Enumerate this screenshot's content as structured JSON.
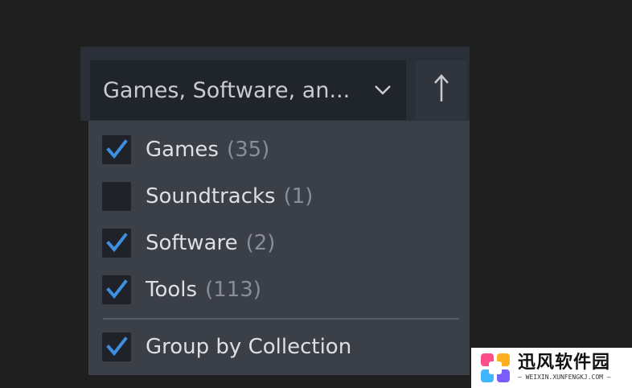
{
  "filter_dropdown": {
    "selected_label": "Games, Software, an...",
    "chevron_icon": "chevron-down-icon"
  },
  "sort_button": {
    "icon": "arrow-up-icon"
  },
  "menu": {
    "items": [
      {
        "label": "Games",
        "count": "(35)",
        "checked": true
      },
      {
        "label": "Soundtracks",
        "count": "(1)",
        "checked": false
      },
      {
        "label": "Software",
        "count": "(2)",
        "checked": true
      },
      {
        "label": "Tools",
        "count": "(113)",
        "checked": true
      }
    ],
    "group_option": {
      "label": "Group by Collection",
      "checked": true
    }
  },
  "watermark": {
    "title": "迅风软件园",
    "subtitle": "— WEIXIN.XUNFENGKJ.COM —"
  },
  "colors": {
    "background": "#1f1f1f",
    "menu_bg": "#3b3f48",
    "checkbox_bg": "#1f2229",
    "check_blue": "#3d8fe0",
    "text": "#dcdfe4",
    "count_text": "#888d96"
  }
}
